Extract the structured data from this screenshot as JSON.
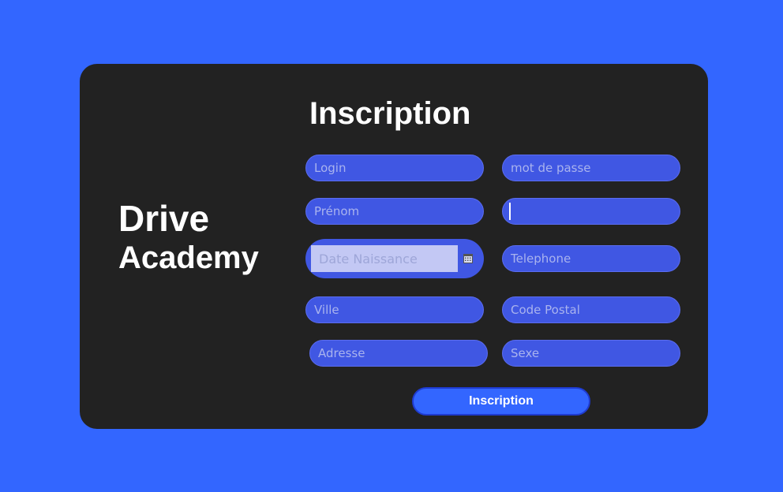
{
  "brand": {
    "line1": "Drive",
    "line2": "Academy"
  },
  "form": {
    "title": "Inscription",
    "login_placeholder": "Login",
    "password_placeholder": "mot de passe",
    "prenom_placeholder": "Prénom",
    "nom_value": "",
    "date_placeholder": "Date Naissance",
    "telephone_placeholder": "Telephone",
    "ville_placeholder": "Ville",
    "code_postal_placeholder": "Code Postal",
    "adresse_placeholder": "Adresse",
    "sexe_placeholder": "Sexe",
    "submit_label": "Inscription"
  },
  "colors": {
    "background": "#3366ff",
    "card": "#222222",
    "field": "#4057e3",
    "button": "#3366ff"
  }
}
